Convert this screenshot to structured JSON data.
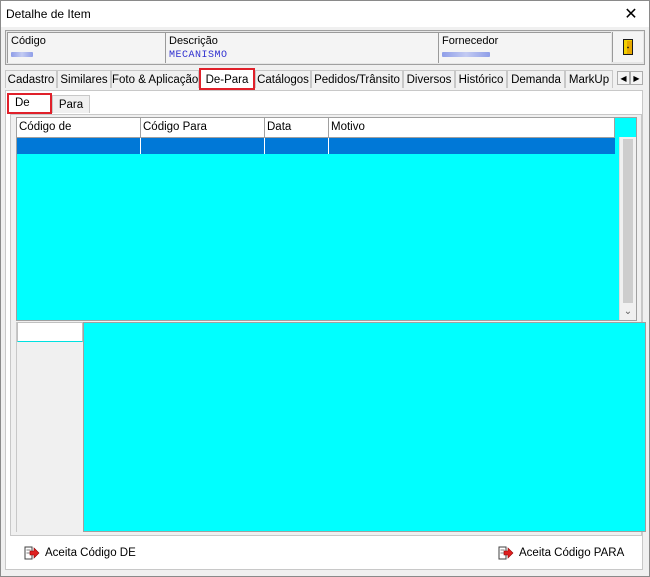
{
  "window": {
    "title": "Detalhe de Item",
    "close_glyph": "✕"
  },
  "header": {
    "codigo_label": "Código",
    "descricao_label": "Descrição",
    "descricao_value": "MECANISMO",
    "fornecedor_label": "Fornecedor"
  },
  "tabs": [
    "Cadastro",
    "Similares",
    "Foto & Aplicação",
    "De-Para",
    "Catálogos",
    "Pedidos/Trânsito",
    "Diversos",
    "Histórico",
    "Demanda",
    "MarkUp"
  ],
  "active_tab": "De-Para",
  "subtabs": [
    "De",
    "Para"
  ],
  "active_subtab": "De",
  "grid": {
    "columns": [
      "Código de",
      "Código Para",
      "Data",
      "Motivo"
    ]
  },
  "buttons": {
    "accept_de": "Aceita Código DE",
    "accept_para": "Aceita Código PARA"
  },
  "colors": {
    "grid_background": "#00ffff",
    "selection": "#0078d7",
    "highlight_border": "#e0202a"
  }
}
